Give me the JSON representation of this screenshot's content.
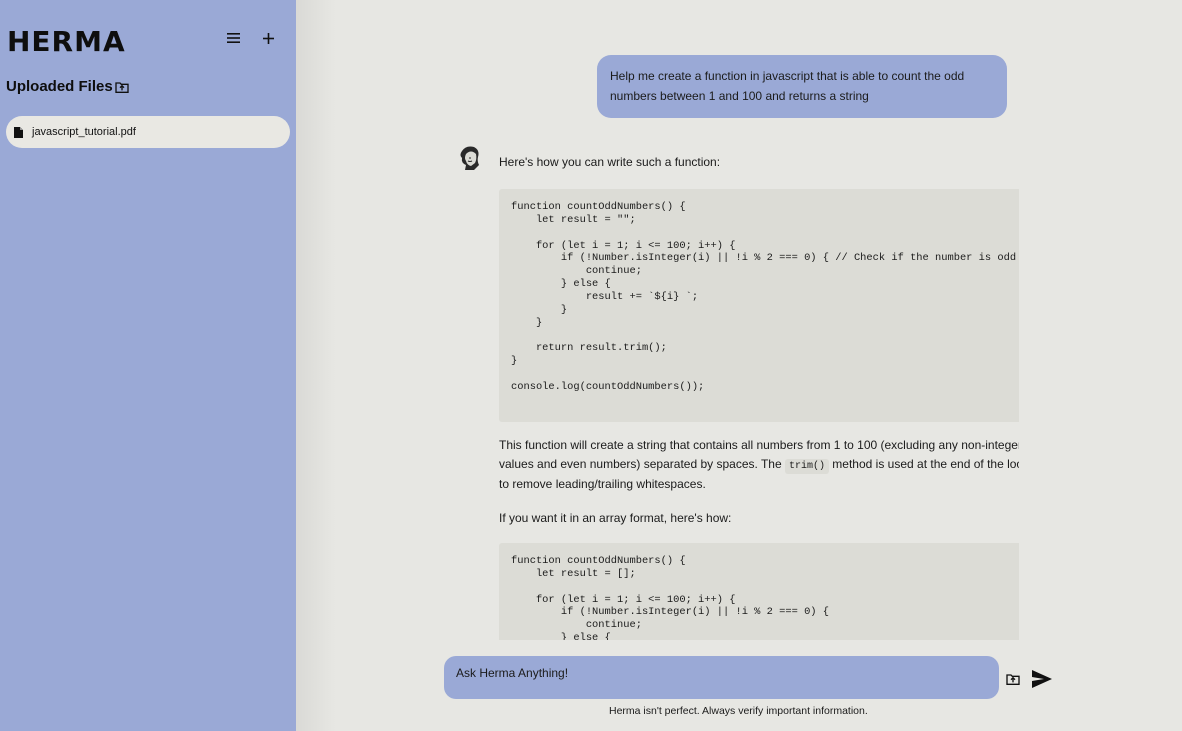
{
  "app": {
    "logo": "HERMA"
  },
  "sidebar": {
    "title": "Uploaded Files",
    "files": [
      {
        "name": "javascript_tutorial.pdf"
      }
    ]
  },
  "chat": {
    "user_message": "Help me create a function in javascript that is able to count the odd numbers between 1 and 100 and returns a string",
    "assistant": {
      "intro": "Here's how you can write such a function:",
      "code_block_1": "function countOddNumbers() {\n    let result = \"\";\n\n    for (let i = 1; i <= 100; i++) {\n        if (!Number.isInteger(i) || !i % 2 === 0) { // Check if the number is odd\n            continue;\n        } else {\n            result += `${i} `;\n        }\n    }\n\n    return result.trim();\n}\n\nconsole.log(countOddNumbers());",
      "explanation_line1": "This function will create a string that contains all numbers from 1 to 100 (excluding any non-integer",
      "explanation_line2_before": "values and even numbers) separated by spaces. The ",
      "explanation_inline_code": "trim()",
      "explanation_line2_after": " method is used at the end of the loop",
      "explanation_line3": "to remove leading/trailing whitespaces.",
      "array_intro": "If you want it in an array format, here's how:",
      "code_block_2": "function countOddNumbers() {\n    let result = [];\n\n    for (let i = 1; i <= 100; i++) {\n        if (!Number.isInteger(i) || !i % 2 === 0) {\n            continue;\n        } else {"
    }
  },
  "input": {
    "placeholder": "Ask Herma Anything!"
  },
  "footer": {
    "disclaimer": "Herma isn't perfect. Always verify important information."
  },
  "colors": {
    "sidebar": "#9aa9d6",
    "background": "#e7e7e3",
    "code_bg": "#dcdcd6",
    "file_pill": "#e9e8e3"
  }
}
